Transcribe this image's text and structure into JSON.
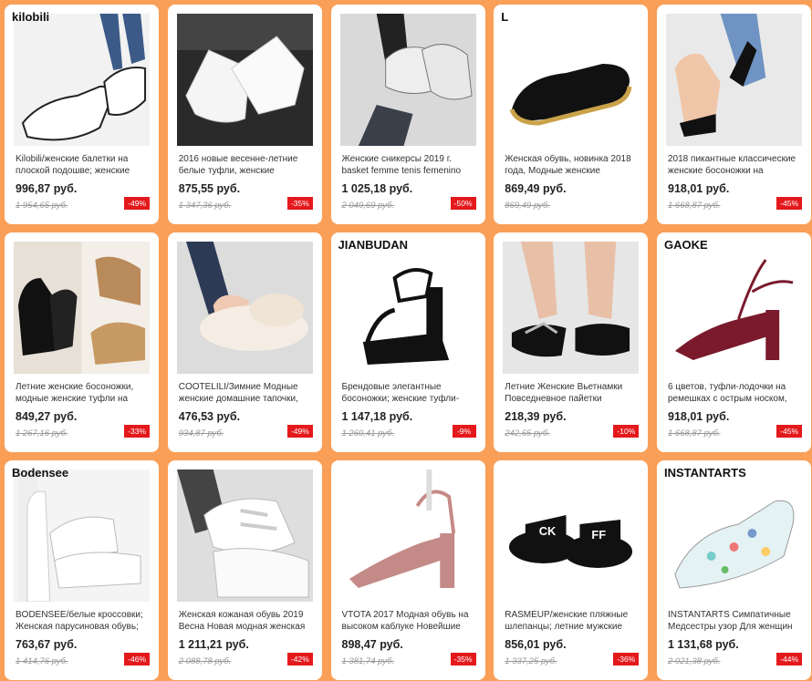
{
  "products": [
    {
      "brand": "kilobili",
      "title": "Kilobili/женские балетки на плоской подошве; женские",
      "price": "996,87 руб.",
      "old_price": "1 954,65 руб.",
      "discount": "-49%",
      "scene": "flat-white"
    },
    {
      "brand": "",
      "title": "2016 новые весенне-летние белые туфли, женские",
      "price": "875,55 руб.",
      "old_price": "1 347,36 руб.",
      "discount": "-35%",
      "scene": "sneaker-white"
    },
    {
      "brand": "",
      "title": "Женские сникерсы 2019 г. basket femme tenis femenino",
      "price": "1 025,18 руб.",
      "old_price": "2 049,69 руб.",
      "discount": "-50%",
      "scene": "sneaker-gray"
    },
    {
      "brand": "L",
      "title": "Женская обувь, новинка 2018 года, Модные женские",
      "price": "869,49 руб.",
      "old_price": "869,49 руб.",
      "discount": "",
      "scene": "slipon-black"
    },
    {
      "brand": "",
      "title": "2018 пикантные классические женские босоножки на",
      "price": "918,01 руб.",
      "old_price": "1 668,87 руб.",
      "discount": "-45%",
      "scene": "heel-black"
    },
    {
      "brand": "",
      "title": "Летние женские босоножки, модные женские туфли на",
      "price": "849,27 руб.",
      "old_price": "1 267,16 руб.",
      "discount": "-33%",
      "scene": "sandal-black"
    },
    {
      "brand": "",
      "title": "COOTELILI/Зимние Модные женские домашние тапочки,",
      "price": "476,53 руб.",
      "old_price": "934,87 руб.",
      "discount": "-49%",
      "scene": "fur-slipper"
    },
    {
      "brand": "JIANBUDAN",
      "title": "Брендовые элегантные босоножки; женские туфли-",
      "price": "1 147,18 руб.",
      "old_price": "1 260,41 руб.",
      "discount": "-9%",
      "scene": "platform-black"
    },
    {
      "brand": "",
      "title": "Летние Женские Вьетнамки Повседневное пайетки",
      "price": "218,39 руб.",
      "old_price": "242,65 руб.",
      "discount": "-10%",
      "scene": "flipflop"
    },
    {
      "brand": "GAOKE",
      "title": "6 цветов, туфли-лодочки на ремешках с острым носком,",
      "price": "918,01 руб.",
      "old_price": "1 668,87 руб.",
      "discount": "-45%",
      "scene": "pump-burgundy"
    },
    {
      "brand": "Bodensee",
      "title": "BODENSEE/белые кроссовки; Женская парусиновая обувь;",
      "price": "763,67 руб.",
      "old_price": "1 414,76 руб.",
      "discount": "-46%",
      "scene": "sneaker-white2"
    },
    {
      "brand": "",
      "title": "Женская кожаная обувь 2019 Весна Новая модная женская",
      "price": "1 211,21 руб.",
      "old_price": "2 088,78 руб.",
      "discount": "-42%",
      "scene": "velcro-white"
    },
    {
      "brand": "",
      "title": "VTOTA 2017 Модная обувь на высоком каблуке Новейшие",
      "price": "898,47 руб.",
      "old_price": "1 381,74 руб.",
      "discount": "-35%",
      "scene": "pump-pink"
    },
    {
      "brand": "",
      "title": "RASMEUP/женские пляжные шлепанцы; летние мужские",
      "price": "856,01 руб.",
      "old_price": "1 337,25 руб.",
      "discount": "-36%",
      "scene": "slide-black"
    },
    {
      "brand": "INSTANTARTS",
      "title": "INSTANTARTS Симпатичные Медсестры узор Для женщин",
      "price": "1 131,68 руб.",
      "old_price": "2 021,38 руб.",
      "discount": "-44%",
      "scene": "print-sneaker"
    }
  ]
}
